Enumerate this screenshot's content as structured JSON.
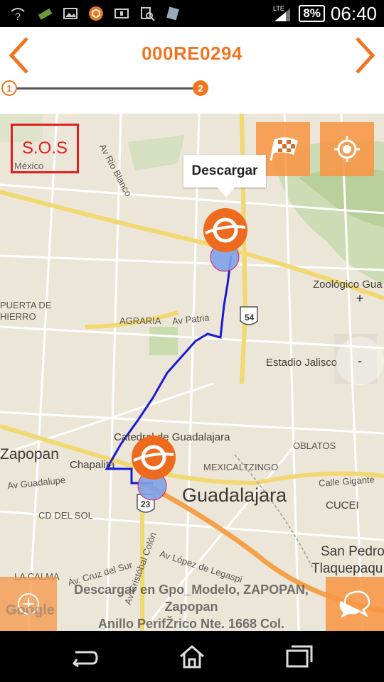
{
  "status_bar": {
    "network": "LTE",
    "battery": "8%",
    "time": "06:40"
  },
  "header": {
    "title": "000RE0294",
    "steps": [
      "1",
      "2"
    ]
  },
  "map": {
    "sos_label": "S.O.S",
    "popup_label": "Descargar",
    "labels": {
      "mexico": "México",
      "av_rio_blanco": "Av Rio Blanco",
      "puerta_de_hierro": "PUERTA DE\nHIERRO",
      "agraria": "AGRARIA",
      "av_patria": "Av Patria",
      "zoologico": "Zoológico Gua",
      "estadio": "Estadio Jalisco",
      "catedral": "Catedral de Guadalajara",
      "oblatos": "OBLATOS",
      "zapopan": "Zapopan",
      "chapalita": "Chapalita",
      "av_guadalupe": "Av Guadalupe",
      "mexicaltzingo": "MEXICALTZINGO",
      "guadalajara": "Guadalajara",
      "calle_gigante": "Calle Gigante",
      "cd_del_sol": "CD DEL SOL",
      "cucei": "CUCEI",
      "san_pedro": "San Pedro",
      "tlaquepaque": "Tlaquepaqu",
      "la_calma": "LA CALMA",
      "cruz_del_sur": "Av. Cruz del Sur",
      "cristobal_colon": "Av Cristóbal Colón",
      "lopez_de_legaspi": "Av López de Legaspi",
      "route_54": "54",
      "route_23": "23"
    },
    "zoom_in": "+",
    "zoom_out": "-",
    "google": "Google",
    "address_line1": "Descargar en Gpo_Modelo, ZAPOPAN,",
    "address_line2": "Zapopan",
    "address_line3": "Anillo PerifŽrico Nte. 1668 Col."
  },
  "colors": {
    "accent": "#ee7623",
    "route": "#1a1ad6",
    "sos": "#e02020"
  },
  "icons": {
    "back": "chevron-left-icon",
    "forward": "chevron-right-icon",
    "flag": "checkered-flag-icon",
    "locate": "crosshair-icon",
    "chat": "chat-bubbles-icon",
    "add": "add-circle-icon"
  }
}
